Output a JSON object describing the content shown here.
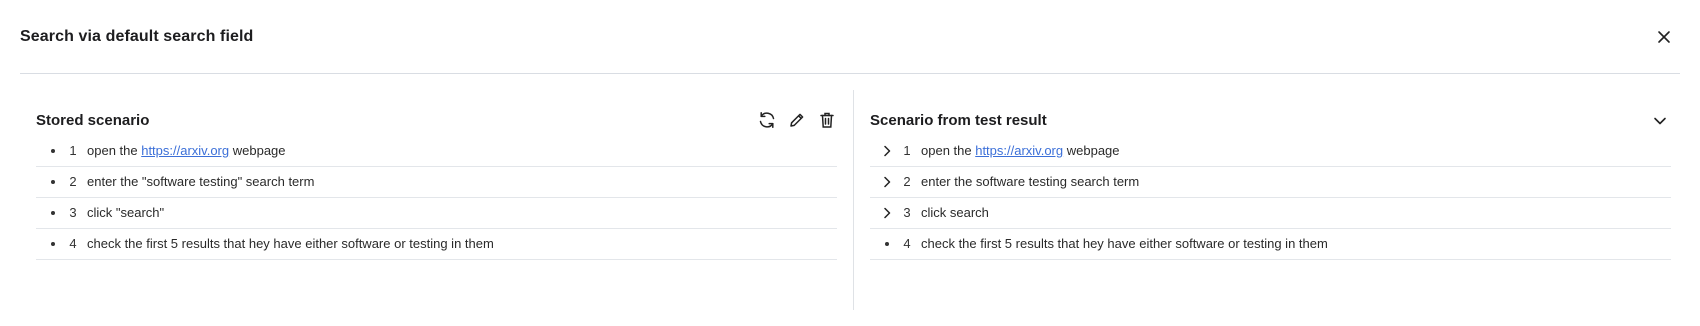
{
  "dialog": {
    "title": "Search via default search field",
    "close_icon": "close-icon"
  },
  "stored": {
    "title": "Stored scenario",
    "tools": [
      "refresh-icon",
      "pencil-icon",
      "trash-icon"
    ],
    "steps": [
      {
        "num": "1",
        "prefix": "open the ",
        "link": "https://arxiv.org",
        "suffix": " webpage",
        "marker": "bullet"
      },
      {
        "num": "2",
        "text": "enter the \"software testing\" search term",
        "marker": "bullet"
      },
      {
        "num": "3",
        "text": "click \"search\"",
        "marker": "bullet"
      },
      {
        "num": "4",
        "text": "check the first 5 results that hey have either software or testing in them",
        "marker": "bullet"
      }
    ]
  },
  "result": {
    "title": "Scenario from test result",
    "collapse_icon": "chevron-down-icon",
    "steps": [
      {
        "num": "1",
        "prefix": "open the ",
        "link": "https://arxiv.org",
        "suffix": " webpage",
        "marker": "chevron-right-icon"
      },
      {
        "num": "2",
        "text": "enter the software testing search term",
        "marker": "chevron-right-icon"
      },
      {
        "num": "3",
        "text": "click search",
        "marker": "chevron-right-icon"
      },
      {
        "num": "4",
        "text": "check the first 5 results that hey have either software or testing in them",
        "marker": "bullet"
      }
    ]
  },
  "colors": {
    "link": "#3b6fd8",
    "divider": "#e3e6ea",
    "text": "#1f1f1f"
  }
}
